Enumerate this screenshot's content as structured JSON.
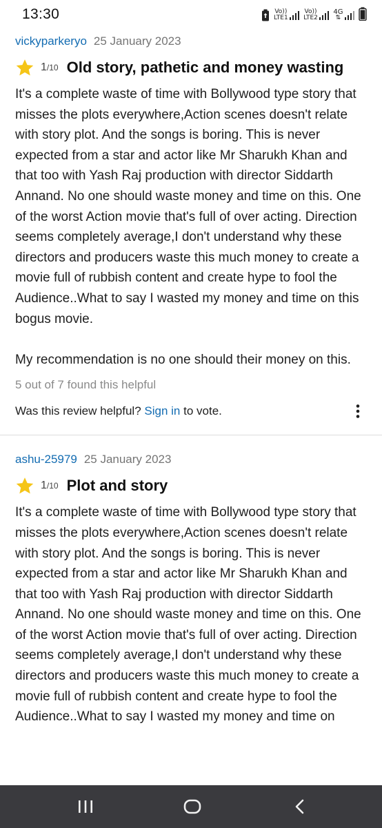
{
  "status_bar": {
    "time": "13:30",
    "sim1_label_top": "Vo))",
    "sim1_label_bottom": "LTE1",
    "sim2_label_top": "Vo))",
    "sim2_label_bottom": "LTE2",
    "network_type": "4G"
  },
  "reviews": [
    {
      "author": "vickyparkeryo",
      "date": "25 January 2023",
      "score": "1",
      "score_max": "/10",
      "title": "Old story, pathetic and money wasting",
      "body": [
        "It's a complete waste of time with Bollywood type story that misses the plots everywhere,Action scenes doesn't relate with story plot. And the songs is boring. This is never expected from a star and actor like Mr Sharukh Khan and that too with Yash Raj production with director Siddarth Annand. No one should waste money and time on this. One of the worst Action movie that's full of over acting. Direction seems completely average,I don't understand why these directors and producers waste this much money to create a movie full of rubbish content and create hype to fool the Audience..What to say I wasted my money and time on this bogus movie.",
        "My recommendation is no one should their money on this."
      ],
      "helpful": "5 out of 7 found this helpful",
      "vote_prefix": "Was this review helpful?",
      "vote_link": "Sign in",
      "vote_suffix": "to vote."
    },
    {
      "author": "ashu-25979",
      "date": "25 January 2023",
      "score": "1",
      "score_max": "/10",
      "title": "Plot and story",
      "body": [
        "It's a complete waste of time with Bollywood type story that misses the plots everywhere,Action scenes doesn't relate with story plot. And the songs is boring. This is never expected from a star and actor like Mr Sharukh Khan and that too with Yash Raj production with director Siddarth Annand. No one should waste money and time on this. One of the worst Action movie that's full of over acting. Direction seems completely average,I don't understand why these directors and producers waste this much money to create a movie full of rubbish content and create hype to fool the Audience..What to say I wasted my money and time on"
      ]
    }
  ],
  "icons": {
    "rating": "star-icon",
    "more": "more-vertical-icon",
    "nav_recents": "recent-apps-icon",
    "nav_home": "home-icon",
    "nav_back": "back-icon"
  },
  "colors": {
    "link": "#136cb2",
    "star": "#f5c518",
    "nav_bar": "#3a3a3e"
  }
}
